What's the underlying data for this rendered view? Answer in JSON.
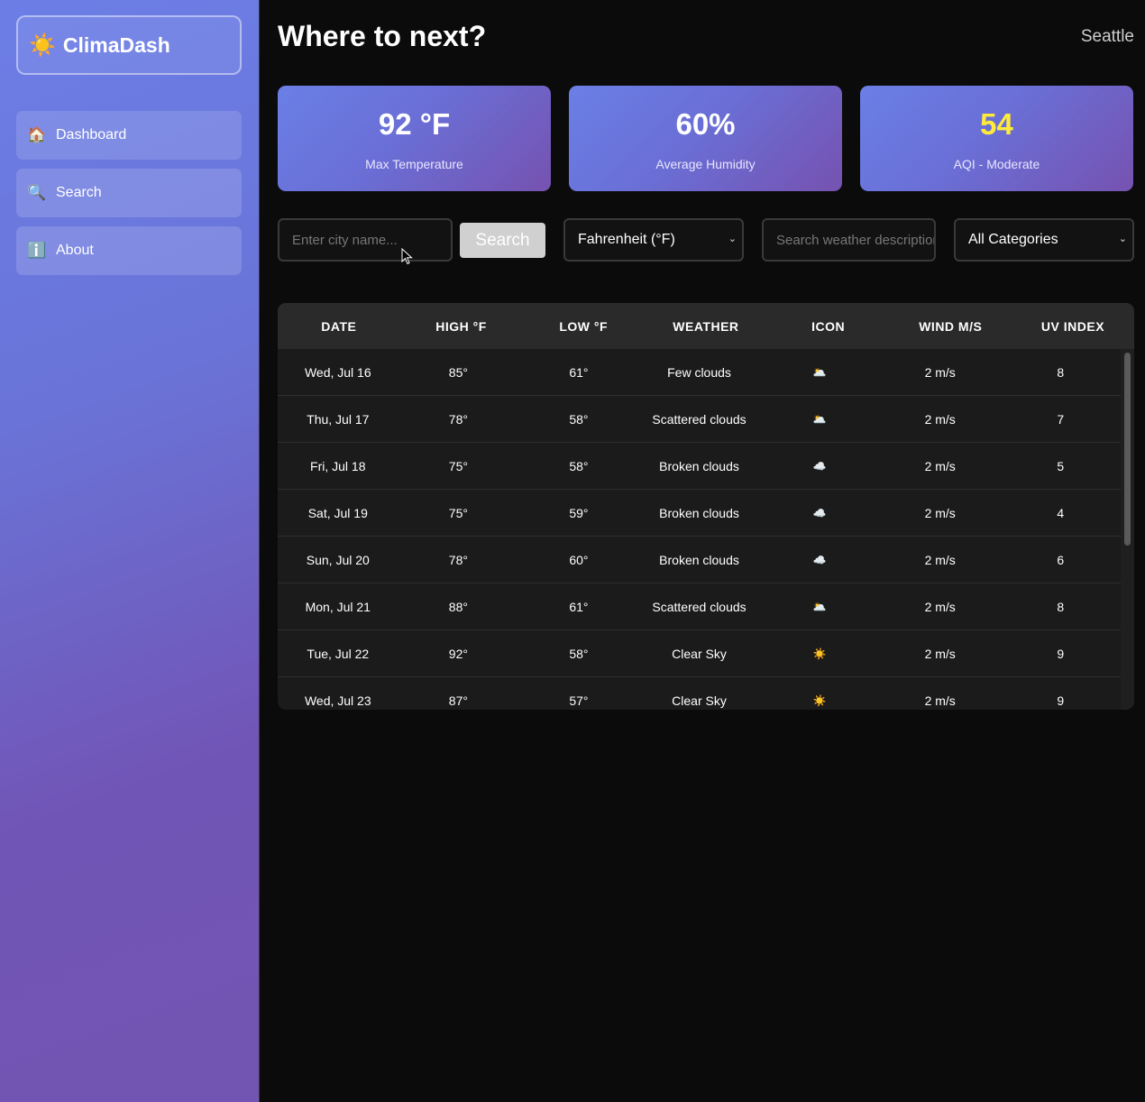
{
  "sidebar": {
    "brand": {
      "icon": "☀️",
      "title": "ClimaDash"
    },
    "items": [
      {
        "icon": "🏠",
        "label": "Dashboard"
      },
      {
        "icon": "🔍",
        "label": "Search"
      },
      {
        "icon": "ℹ️",
        "label": "About"
      }
    ]
  },
  "header": {
    "title": "Where to next?",
    "city": "Seattle"
  },
  "stats": [
    {
      "value": "92 °F",
      "label": "Max Temperature"
    },
    {
      "value": "60%",
      "label": "Average Humidity"
    },
    {
      "value": "54",
      "label": "AQI - Moderate",
      "color": "#ffeb3b"
    }
  ],
  "controls": {
    "city_placeholder": "Enter city name...",
    "search_label": "Search",
    "unit_value": "Fahrenheit (°F)",
    "desc_placeholder": "Search weather description",
    "category_value": "All Categories"
  },
  "table": {
    "headers": [
      "DATE",
      "HIGH °F",
      "LOW °F",
      "WEATHER",
      "ICON",
      "WIND M/S",
      "UV INDEX"
    ],
    "rows": [
      [
        "Wed, Jul 16",
        "85°",
        "61°",
        "Few clouds",
        "🌥️",
        "2 m/s",
        "8"
      ],
      [
        "Thu, Jul 17",
        "78°",
        "58°",
        "Scattered clouds",
        "🌥️",
        "2 m/s",
        "7"
      ],
      [
        "Fri, Jul 18",
        "75°",
        "58°",
        "Broken clouds",
        "☁️",
        "2 m/s",
        "5"
      ],
      [
        "Sat, Jul 19",
        "75°",
        "59°",
        "Broken clouds",
        "☁️",
        "2 m/s",
        "4"
      ],
      [
        "Sun, Jul 20",
        "78°",
        "60°",
        "Broken clouds",
        "☁️",
        "2 m/s",
        "6"
      ],
      [
        "Mon, Jul 21",
        "88°",
        "61°",
        "Scattered clouds",
        "🌥️",
        "2 m/s",
        "8"
      ],
      [
        "Tue, Jul 22",
        "92°",
        "58°",
        "Clear Sky",
        "☀️",
        "2 m/s",
        "9"
      ],
      [
        "Wed, Jul 23",
        "87°",
        "57°",
        "Clear Sky",
        "☀️",
        "2 m/s",
        "9"
      ]
    ]
  }
}
